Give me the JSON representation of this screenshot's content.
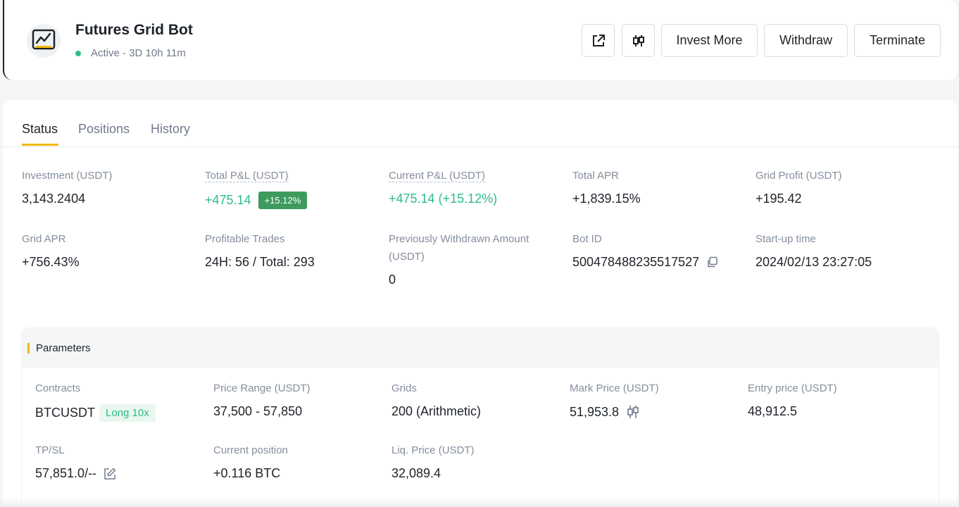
{
  "header": {
    "title": "Futures Grid Bot",
    "status": "Active - 3D 10h 11m",
    "buttons": {
      "invest_more": "Invest More",
      "withdraw": "Withdraw",
      "terminate": "Terminate"
    },
    "icons": [
      "share-icon",
      "candlestick-icon"
    ]
  },
  "tabs": [
    "Status",
    "Positions",
    "History"
  ],
  "stats": [
    {
      "label": "Investment (USDT)",
      "value": "3,143.2404"
    },
    {
      "label": "Total P&L (USDT)",
      "value": "+475.14",
      "badge": "+15.12%"
    },
    {
      "label": "Current P&L (USDT)",
      "value": "+475.14 (+15.12%)"
    },
    {
      "label": "Total APR",
      "value": "+1,839.15%"
    },
    {
      "label": "Grid Profit (USDT)",
      "value": "+195.42"
    },
    {
      "label": "Grid APR",
      "value": "+756.43%"
    },
    {
      "label": "Profitable Trades",
      "value": "24H: 56 / Total: 293"
    },
    {
      "label": "Previously Withdrawn Amount (USDT)",
      "value": "0"
    },
    {
      "label": "Bot ID",
      "value": "500478488235517527"
    },
    {
      "label": "Start-up time",
      "value": "2024/02/13 23:27:05"
    }
  ],
  "parameters": {
    "title": "Parameters",
    "items": [
      {
        "label": "Contracts",
        "value": "BTCUSDT",
        "badge": "Long 10x"
      },
      {
        "label": "Price Range (USDT)",
        "value": "37,500 - 57,850"
      },
      {
        "label": "Grids",
        "value": "200 (Arithmetic)"
      },
      {
        "label": "Mark Price (USDT)",
        "value": "51,953.8"
      },
      {
        "label": "Entry price (USDT)",
        "value": "48,912.5"
      },
      {
        "label": "TP/SL",
        "value": "57,851.0/--"
      },
      {
        "label": "Current position",
        "value": "+0.116 BTC"
      },
      {
        "label": "Liq. Price (USDT)",
        "value": "32,089.4"
      }
    ]
  },
  "colors": {
    "accent": "#f0b90b",
    "positive": "#2ebd85",
    "badge_bg": "#3f9a5e",
    "text": "#1e2329",
    "muted": "#848e9c"
  }
}
